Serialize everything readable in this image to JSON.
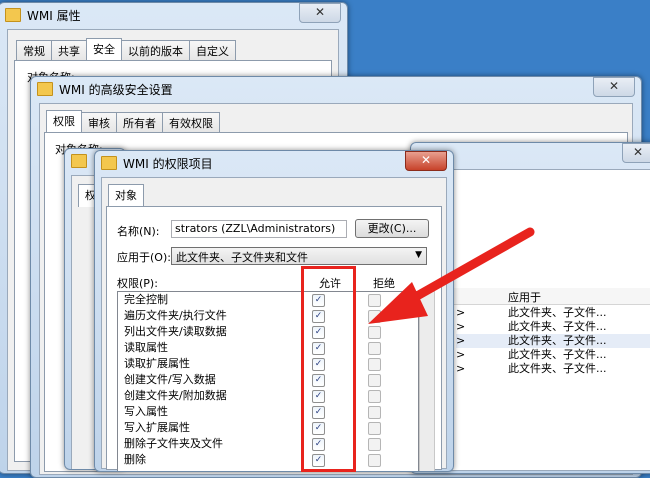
{
  "win_props": {
    "title": "WMI 属性",
    "tabs": [
      "常规",
      "共享",
      "安全",
      "以前的版本",
      "自定义"
    ],
    "active_tab": 2,
    "object_name_label": "对象名称:"
  },
  "win_advanced": {
    "title": "WMI 的高级安全设置",
    "tabs": [
      "权限",
      "审核",
      "所有者",
      "有效权限"
    ],
    "active_tab": 0,
    "object_name_label": "对象名称:"
  },
  "win_mid": {
    "tab_partial": "权"
  },
  "win_right": {
    "col_header": "应用于",
    "rows": [
      {
        "pre": ">",
        "val": "此文件夹、子文件..."
      },
      {
        "pre": ">",
        "val": "此文件夹、子文件..."
      },
      {
        "pre": ">",
        "val": "此文件夹、子文件..."
      },
      {
        "pre": ">",
        "val": "此文件夹、子文件..."
      },
      {
        "pre": ">",
        "val": "此文件夹、子文件..."
      }
    ]
  },
  "win_entry": {
    "title": "WMI 的权限项目",
    "tab": "对象",
    "name_label": "名称(N):",
    "name_value": "strators (ZZL\\Administrators)",
    "change_button": "更改(C)...",
    "apply_label": "应用于(O):",
    "apply_value": "此文件夹、子文件夹和文件",
    "perm_label": "权限(P):",
    "allow_header": "允许",
    "deny_header": "拒绝",
    "permissions": [
      {
        "name": "完全控制",
        "allow": true,
        "deny": false
      },
      {
        "name": "遍历文件夹/执行文件",
        "allow": true,
        "deny": false
      },
      {
        "name": "列出文件夹/读取数据",
        "allow": true,
        "deny": false
      },
      {
        "name": "读取属性",
        "allow": true,
        "deny": false
      },
      {
        "name": "读取扩展属性",
        "allow": true,
        "deny": false
      },
      {
        "name": "创建文件/写入数据",
        "allow": true,
        "deny": false
      },
      {
        "name": "创建文件夹/附加数据",
        "allow": true,
        "deny": false
      },
      {
        "name": "写入属性",
        "allow": true,
        "deny": false
      },
      {
        "name": "写入扩展属性",
        "allow": true,
        "deny": false
      },
      {
        "name": "删除子文件夹及文件",
        "allow": true,
        "deny": false
      },
      {
        "name": "删除",
        "allow": true,
        "deny": false
      }
    ]
  },
  "colors": {
    "desktop": "#3a7fc7",
    "annotation_red": "#e8231d",
    "close_red": "#c7422a"
  }
}
